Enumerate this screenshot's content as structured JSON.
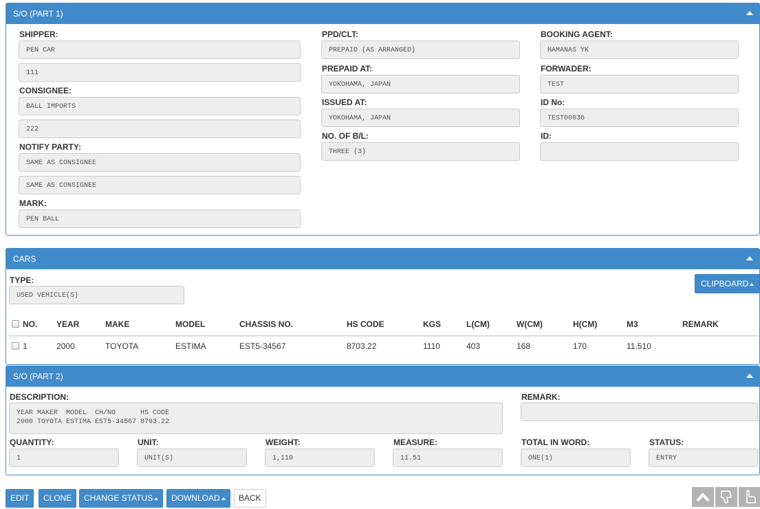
{
  "part1": {
    "title": "S/O (PART 1)",
    "shipper_label": "SHIPPER:",
    "shipper_1": "PEN CAR",
    "shipper_2": "111",
    "consignee_label": "CONSIGNEE:",
    "consignee_1": "BALL IMPORTS",
    "consignee_2": "222",
    "notify_label": "NOTIFY PARTY:",
    "notify_1": "SAME AS CONSIGNEE",
    "notify_2": "SAME AS CONSIGNEE",
    "mark_label": "MARK:",
    "mark": "PEN BALL",
    "ppd_label": "PPD/CLT:",
    "ppd": "PREPAID (AS ARRANGED)",
    "prepaid_at_label": "PREPAID AT:",
    "prepaid_at": "YOKOHAMA, JAPAN",
    "issued_at_label": "ISSUED AT:",
    "issued_at": "YOKOHAMA, JAPAN",
    "bl_label": "NO. OF B/L:",
    "bl": "THREE (3)",
    "agent_label": "BOOKING AGENT:",
    "agent": "HAMANAS YK",
    "forwader_label": "FORWADER:",
    "forwader": "TEST",
    "idno_label": "ID No:",
    "idno": "TEST00036",
    "id_label": "ID:",
    "id": ""
  },
  "cars": {
    "title": "CARS",
    "type_label": "TYPE:",
    "type": "USED VEHICLE(S)",
    "clipboard_label": "CLIPBOARD",
    "headers": [
      "NO.",
      "YEAR",
      "MAKE",
      "MODEL",
      "CHASSIS NO.",
      "HS CODE",
      "KGS",
      "L(CM)",
      "W(CM)",
      "H(CM)",
      "M3",
      "REMARK"
    ],
    "rows": [
      [
        "1",
        "2000",
        "TOYOTA",
        "ESTIMA",
        "EST5-34567",
        "8703.22",
        "1110",
        "403",
        "168",
        "170",
        "11.510",
        ""
      ]
    ]
  },
  "part2": {
    "title": "S/O (PART 2)",
    "description_label": "DESCRIPTION:",
    "description": "YEAR MAKER  MODEL  CH/NO      HS CODE\n2000 TOYOTA ESTIMA EST5-34567 8703.22",
    "remark_label": "REMARK:",
    "remark": "",
    "quantity_label": "QUANTITY:",
    "quantity": "1",
    "unit_label": "UNIT:",
    "unit": "UNIT(S)",
    "weight_label": "WEIGHT:",
    "weight": "1,110",
    "measure_label": "MEASURE:",
    "measure": "11.51",
    "total_label": "TOTAL IN WORD:",
    "total": "ONE(1)",
    "status_label": "STATUS:",
    "status": "ENTRY"
  },
  "actions": {
    "edit": "EDIT",
    "clone": "CLONE",
    "change_status": "CHANGE STATUS",
    "download": "DOWNLOAD",
    "back": "BACK"
  },
  "colors": {
    "primary": "#428bca",
    "field_bg": "#eeeeee",
    "border": "#cccccc"
  },
  "tools": [
    "scroll-top-icon",
    "thumbs-down-icon",
    "pointer-hand-icon"
  ]
}
